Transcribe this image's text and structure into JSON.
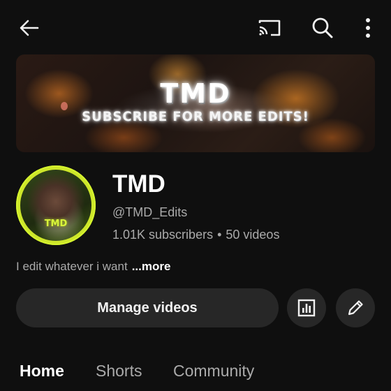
{
  "topbar": {
    "back_icon": "arrow-left-icon",
    "cast_icon": "cast-icon",
    "search_icon": "search-icon",
    "more_icon": "vertical-dots-icon"
  },
  "banner": {
    "title": "TMD",
    "subtitle": "SUBSCRIBE FOR MORE EDITS!"
  },
  "avatar": {
    "label": "TMD"
  },
  "channel": {
    "name": "TMD",
    "handle": "@TMD_Edits",
    "subscribers": "1.01K subscribers",
    "separator": "•",
    "videos": "50 videos",
    "description": "I edit whatever i want",
    "more_label": "...more"
  },
  "actions": {
    "manage_videos_label": "Manage videos",
    "analytics_icon": "analytics-icon",
    "edit_icon": "pencil-icon"
  },
  "tabs": [
    {
      "label": "Home",
      "active": true
    },
    {
      "label": "Shorts",
      "active": false
    },
    {
      "label": "Community",
      "active": false
    }
  ],
  "colors": {
    "background": "#0f0f0f",
    "button_bg": "#272727",
    "secondary_text": "#aaaaaa",
    "avatar_ring": "#cde62a"
  }
}
